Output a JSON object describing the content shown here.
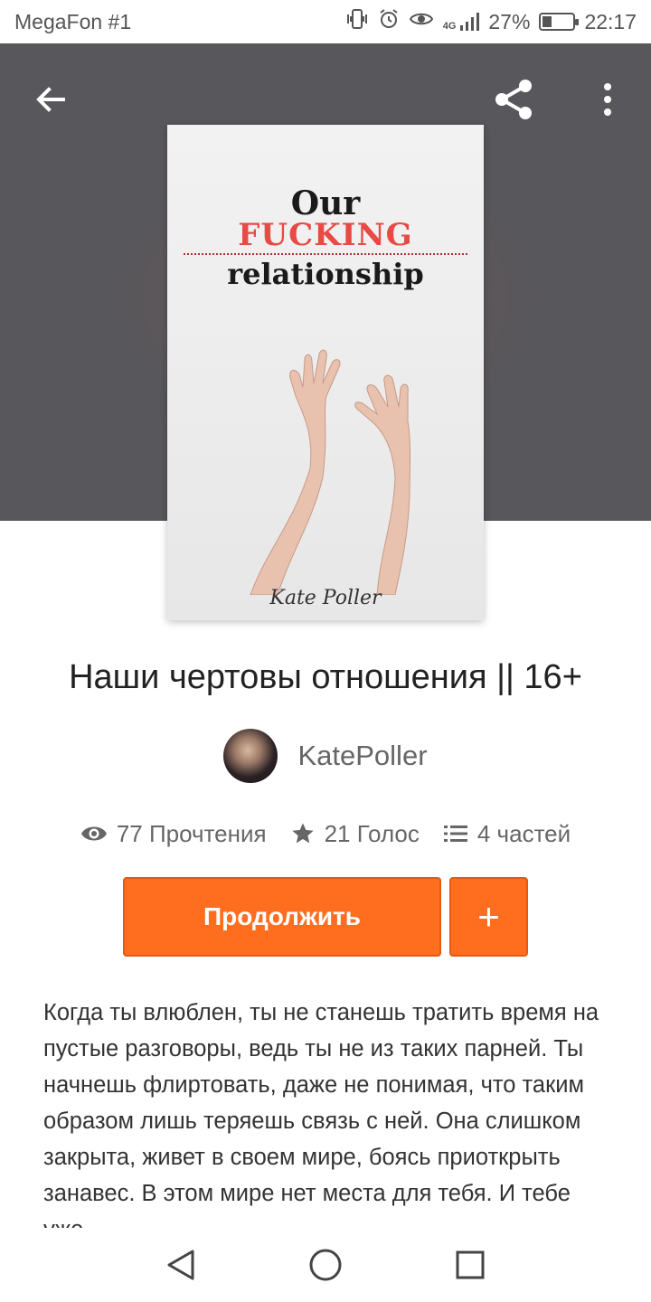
{
  "status_bar": {
    "carrier": "MegaFon #1",
    "network": "4G",
    "battery": "27%",
    "time": "22:17",
    "icons": [
      "vibrate-icon",
      "alarm-icon",
      "eye-icon",
      "signal-icon",
      "battery-icon"
    ]
  },
  "toolbar": {
    "back_icon": "arrow-left-icon",
    "share_icon": "share-icon",
    "more_icon": "more-vertical-icon"
  },
  "cover": {
    "line1": "Our",
    "line2": "FUCKING",
    "line3": "relationship",
    "author": "Kate Poller"
  },
  "story": {
    "title": "Наши чертовы отношения || 16+",
    "author": "KatePoller",
    "reads": "77 Прочтения",
    "votes": "21 Голос",
    "parts": "4 частей",
    "description": "Когда ты влюблен, ты не станешь тратить время на пустые разговоры, ведь ты не из таких парней. Ты начнешь флиртовать, даже не понимая, что таким образом лишь теряешь связь с ней. Она слишком закрыта, живет в своем мире, боясь приоткрыть занавес. В этом мире нет места для тебя. И тебе уже"
  },
  "actions": {
    "continue_label": "Продолжить",
    "add_label": "+"
  },
  "colors": {
    "accent": "#ff6e1e",
    "hero_bg": "#58575b"
  }
}
